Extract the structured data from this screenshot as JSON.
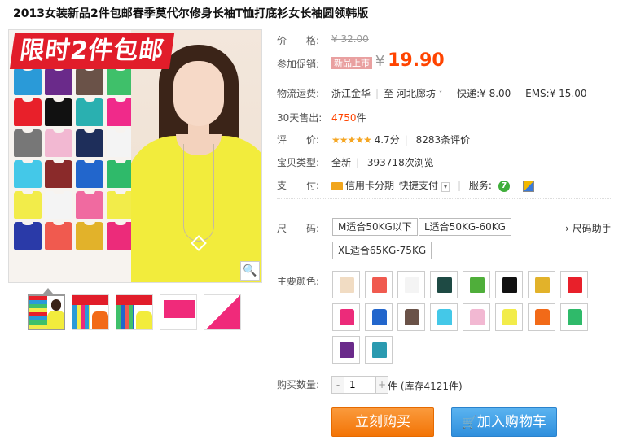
{
  "product": {
    "title": "2013女装新品2件包邮春季莫代尔修身长袖T恤打底衫女长袖圆领韩版",
    "banner_text": "限时2件包邮"
  },
  "price": {
    "label": "价　　格:",
    "original": "¥ 32.00",
    "promo_label": "参加促销:",
    "promo_tag": "新品上市",
    "currency": "¥",
    "current": "19.90"
  },
  "shipping": {
    "label": "物流运费:",
    "from": "浙江金华",
    "to_sep": "至",
    "to": "河北廊坊",
    "express": "快递:¥ 8.00",
    "ems": "EMS:¥ 15.00"
  },
  "sales": {
    "label": "30天售出:",
    "count": "4750",
    "unit": "件"
  },
  "rating": {
    "label": "评　　价:",
    "stars": "★★★★★",
    "score": "4.7分",
    "reviews": "8283条评价"
  },
  "type": {
    "label": "宝贝类型:",
    "value": "全新",
    "views": "393718次浏览"
  },
  "payment": {
    "label": "支　　付:",
    "credit": "信用卡分期",
    "quick": "快捷支付",
    "service_label": "服务:"
  },
  "size": {
    "label": "尺　　码:",
    "options": [
      "M适合50KG以下",
      "L适合50KG-60KG",
      "XL适合65KG-75KG"
    ],
    "help": "› 尺码助手"
  },
  "color": {
    "label": "主要颜色:",
    "swatches": [
      "#f1dcc3",
      "#f05a4f",
      "#f4f4f4",
      "#1e4a44",
      "#4fae3a",
      "#111111",
      "#e2b22a",
      "#e8202a",
      "#ec2b7a",
      "#2266cc",
      "#6a5248",
      "#44c8e8",
      "#f2b8d2",
      "#f2ec4a",
      "#f26a18",
      "#2fba6a",
      "#6a2a8a",
      "#2a9ab0"
    ]
  },
  "quantity": {
    "label": "购买数量:",
    "value": "1",
    "minus": "-",
    "plus": "+",
    "stock": "件 (库存4121件)"
  },
  "actions": {
    "buy": "立刻购买",
    "cart": "加入购物车"
  },
  "icons": {
    "zoom": "magnifier-icon",
    "cart": "cart-icon",
    "card": "credit-card-icon"
  }
}
